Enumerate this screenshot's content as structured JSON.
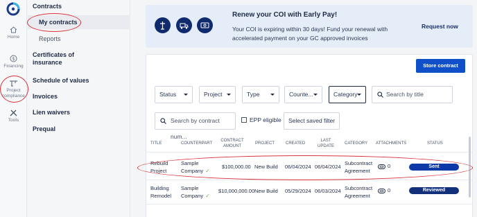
{
  "rail": {
    "items": [
      {
        "label": "Home",
        "icon": "home-icon"
      },
      {
        "label": "Financing",
        "icon": "dollar-icon"
      },
      {
        "label": "Project compliance",
        "icon": "crane-icon"
      },
      {
        "label": "Tools",
        "icon": "tools-icon"
      }
    ]
  },
  "nav": {
    "section_title": "Contracts",
    "items": [
      "My contracts",
      "Reports"
    ],
    "sections": [
      "Certificates of insurance",
      "Schedule of values",
      "Invoices",
      "Lien waivers",
      "Prequal"
    ]
  },
  "banner": {
    "title": "Renew your COI with Early Pay!",
    "text": "Your COI is expiring within 30 days! Fund your renewal with accelerated payment on your GC approved invoices",
    "link": "Request now",
    "icons": [
      "bank-icon",
      "truck-icon",
      "money-icon"
    ]
  },
  "toolbar": {
    "store_button": "Store contract"
  },
  "filters": {
    "dropdowns": [
      "Status",
      "Project",
      "Type",
      "Counte...",
      "Category"
    ],
    "search_title_placeholder": "Search by title",
    "search_number_placeholder": "Search by contract num...",
    "epp_label": "EPP eligible",
    "saved_filter": "Select saved filter"
  },
  "table": {
    "headers": {
      "title": "TITLE",
      "counterpart": "COUNTERPART",
      "amount": "CONTRACT AMOUNT",
      "project": "PROJECT",
      "created": "CREATED",
      "updated": "LAST UPDATE",
      "category": "CATEGORY",
      "attachments": "ATTACHMENTS",
      "status": "STATUS"
    },
    "rows": [
      {
        "title": "Rebuild Project",
        "counterpart": "Sample Company",
        "amount": "$100,000.00",
        "project": "New Build",
        "created": "06/04/2024",
        "updated": "06/04/2024",
        "category": "Subcontract Agreement",
        "attachments": "0",
        "status": "Sent"
      },
      {
        "title": "Building Remodel",
        "counterpart": "Sample Company",
        "amount": "$10,000,000.00",
        "project": "New Build",
        "created": "05/29/2024",
        "updated": "06/03/2024",
        "category": "Subcontract Agreement",
        "attachments": "0",
        "status": "Reviewed"
      }
    ]
  },
  "colors": {
    "primary": "#0f4fc8",
    "navy": "#102a6e",
    "annotation": "#d8323a",
    "check": "#7aa845"
  }
}
